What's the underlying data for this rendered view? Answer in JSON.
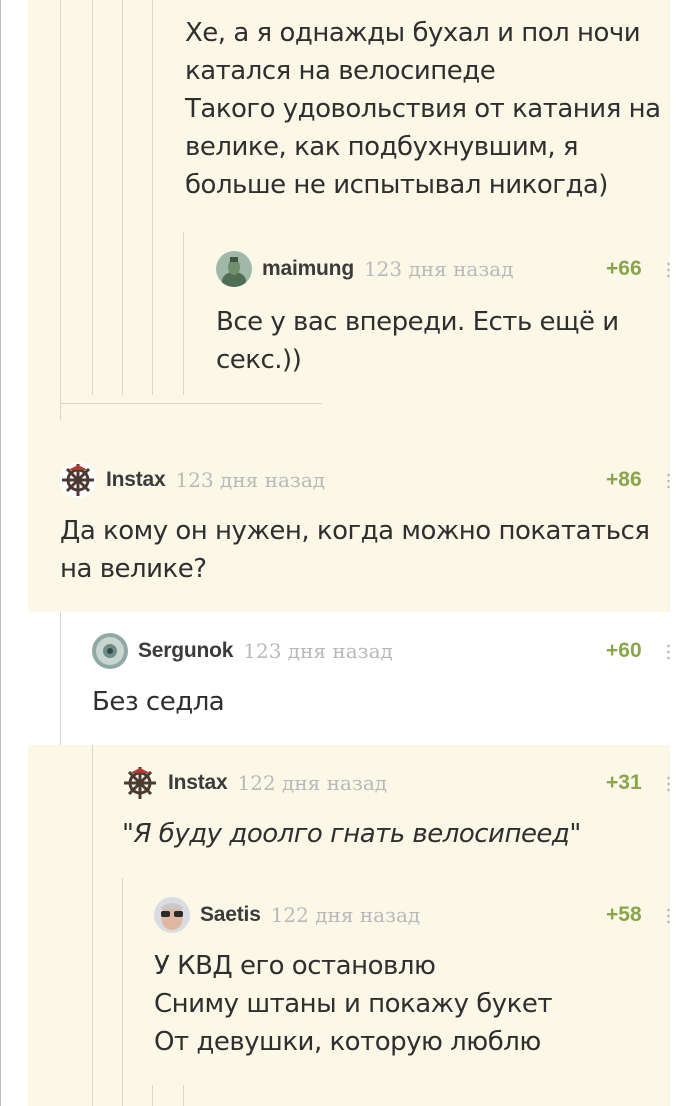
{
  "comments": [
    {
      "text": "Хе, а я однажды бухал и пол ночи\nкатался на велосипеде\nТакого удовольствия от катания на\nвелике, как подбухнувшим, я\nбольше не испытывал никогда)"
    },
    {
      "author": "maimung",
      "time": "123 дня назад",
      "rating": "+66",
      "text": "Все у вас впереди. Есть ещё и\nсекс.))"
    },
    {
      "author": "Instax",
      "time": "123 дня назад",
      "rating": "+86",
      "text": "Да кому он нужен, когда можно покататься\nна велике?"
    },
    {
      "author": "Sergunok",
      "time": "123 дня назад",
      "rating": "+60",
      "text": "Без седла"
    },
    {
      "author": "Instax",
      "time": "122 дня назад",
      "rating": "+31",
      "text": "\"Я буду доолго гнать велосипеед\""
    },
    {
      "author": "Saetis",
      "time": "122 дня назад",
      "rating": "+58",
      "text": "У КВД его остановлю\nСниму штаны и покажу букет\nОт девушки, которую люблю"
    }
  ],
  "colors": {
    "cream": "#fcf8e8",
    "rating": "#8aa54b",
    "time": "#b9b9b9",
    "thread_line": "#d9d6cc"
  }
}
